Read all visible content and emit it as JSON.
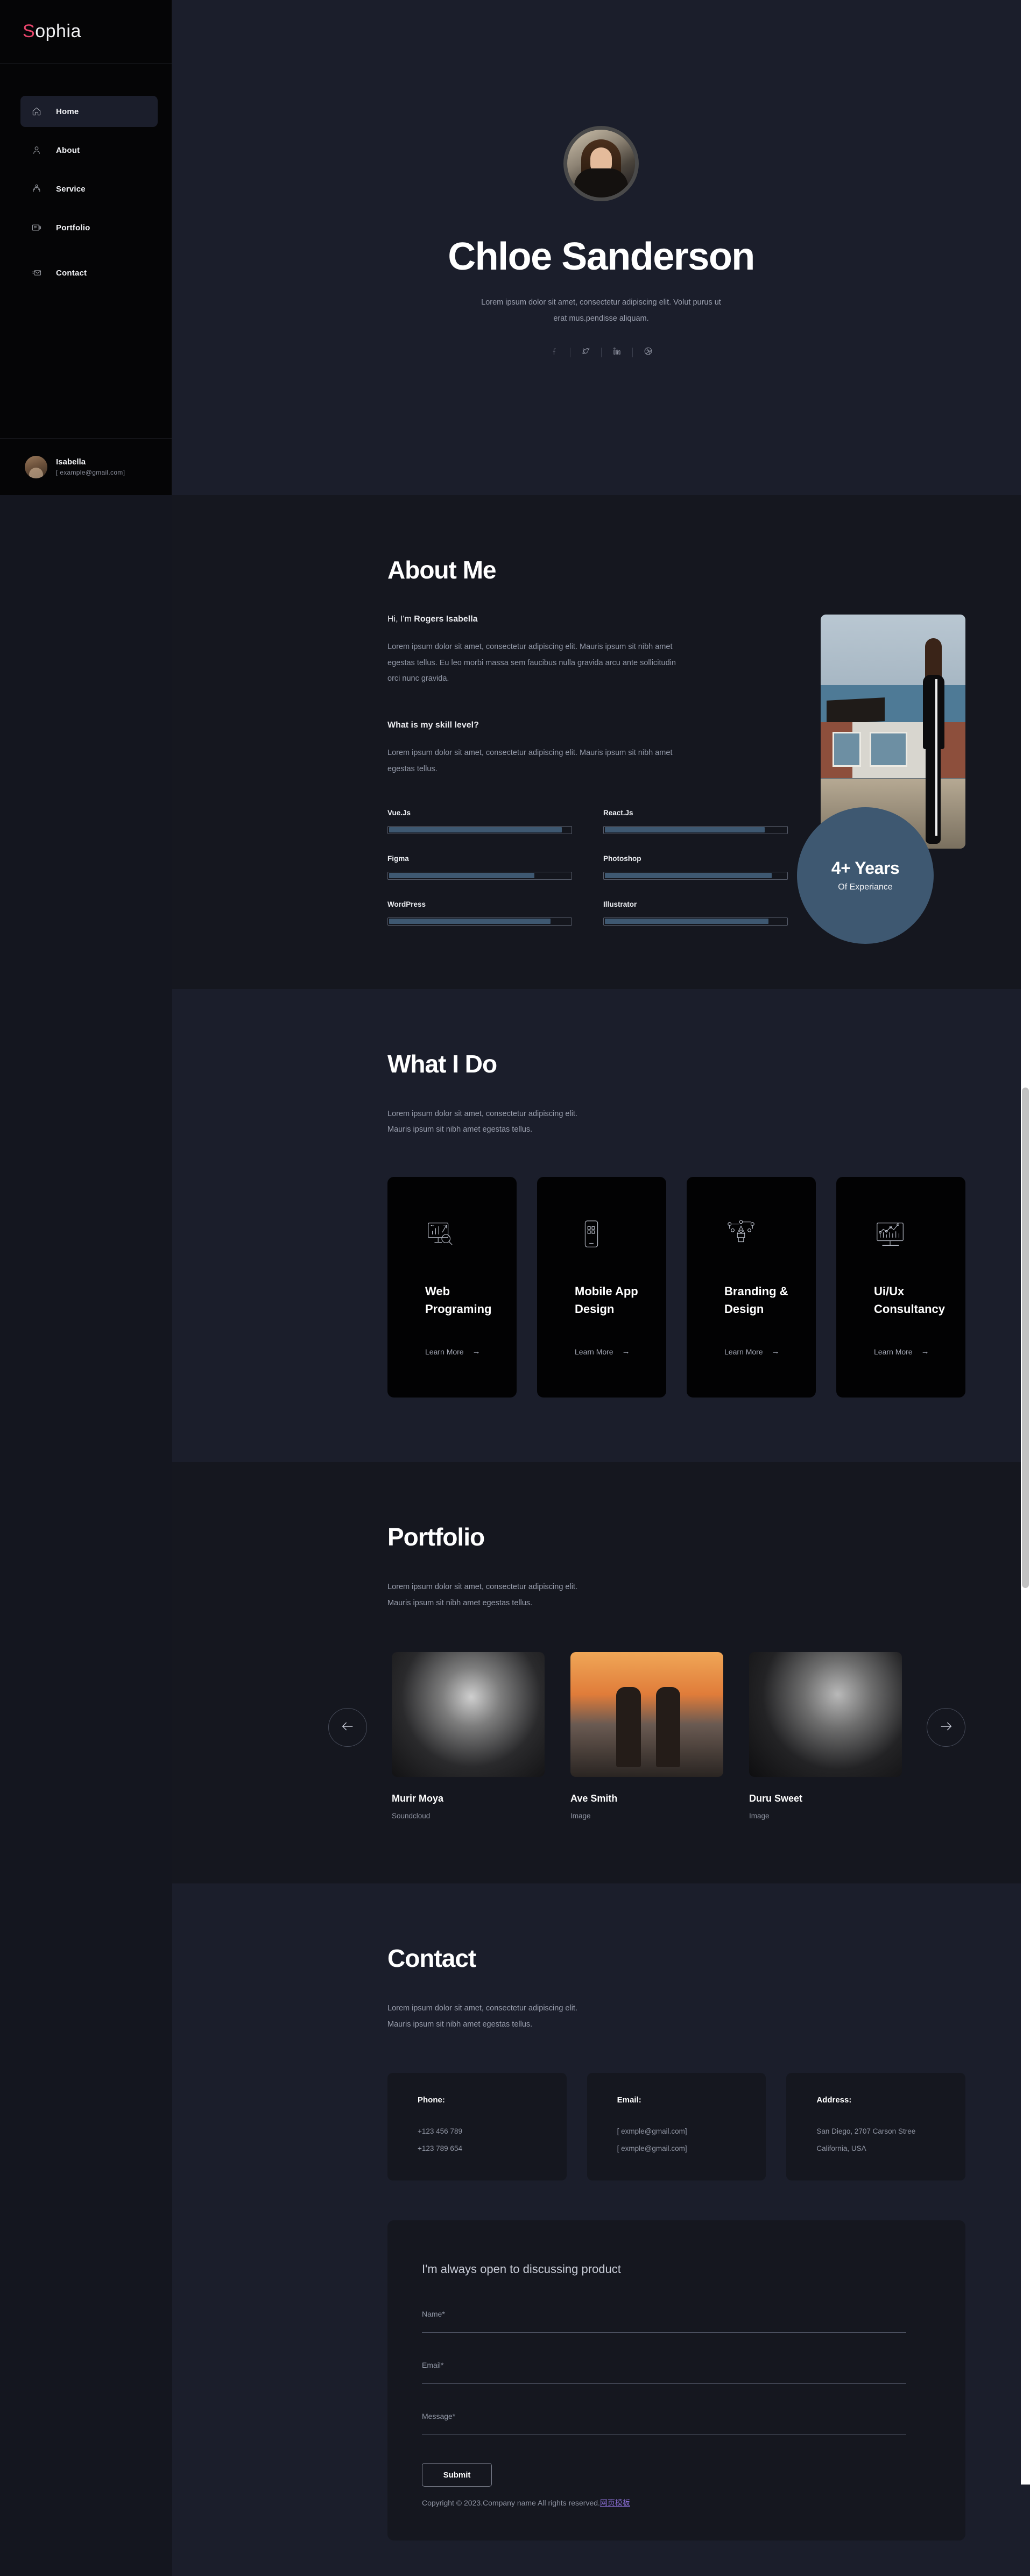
{
  "sidebar": {
    "brand": {
      "accent_letter": "S",
      "rest": "ophia"
    },
    "items": [
      {
        "label": "Home",
        "icon": "home-icon",
        "active": true
      },
      {
        "label": "About",
        "icon": "user-icon",
        "active": false
      },
      {
        "label": "Service",
        "icon": "service-icon",
        "active": false
      },
      {
        "label": "Portfolio",
        "icon": "portfolio-icon",
        "active": false
      },
      {
        "label": "Contact",
        "icon": "mail-icon",
        "active": false
      }
    ],
    "user": {
      "name": "Isabella",
      "email": "[ example@gmail.com]"
    }
  },
  "hero": {
    "name": "Chloe Sanderson",
    "subtitle": "Lorem ipsum dolor sit amet, consectetur adipiscing elit. Volut purus ut erat mus.pendisse aliquam.",
    "socials": [
      "facebook-icon",
      "twitter-icon",
      "linkedin-icon",
      "dribbble-icon"
    ]
  },
  "about": {
    "title": "About Me",
    "greeting_prefix": "Hi, I'm ",
    "greeting_name": "Rogers Isabella",
    "paragraph": "Lorem ipsum dolor sit amet, consectetur adipiscing elit. Mauris ipsum sit nibh amet egestas tellus. Eu leo morbi massa sem faucibus nulla gravida arcu ante sollicitudin orci nunc gravida.",
    "skill_heading": "What is my skill level?",
    "skill_paragraph": "Lorem ipsum dolor sit amet, consectetur adipiscing elit. Mauris ipsum sit nibh amet egestas tellus.",
    "skills": [
      {
        "name": "Vue.Js",
        "percent": 95
      },
      {
        "name": "React.Js",
        "percent": 88
      },
      {
        "name": "Figma",
        "percent": 80
      },
      {
        "name": "Photoshop",
        "percent": 92
      },
      {
        "name": "WordPress",
        "percent": 89
      },
      {
        "name": "Illustrator",
        "percent": 90
      }
    ],
    "badge": {
      "number": "4+ Years",
      "label": "Of Experiance"
    }
  },
  "whatido": {
    "title": "What I Do",
    "lead": "Lorem ipsum dolor sit amet, consectetur adipiscing elit. Mauris ipsum sit nibh amet egestas tellus.",
    "cards": [
      {
        "title": "Web Programing",
        "icon": "monitor-chart-search-icon",
        "more": "Learn More",
        "arrow": "→"
      },
      {
        "title": "Mobile App Design",
        "icon": "smartphone-icon",
        "more": "Learn More",
        "arrow": "→"
      },
      {
        "title": "Branding & Design",
        "icon": "pen-tool-icon",
        "more": "Learn More",
        "arrow": "→"
      },
      {
        "title": "Ui/Ux Consultancy",
        "icon": "monitor-analytics-icon",
        "more": "Learn More",
        "arrow": "→"
      }
    ]
  },
  "portfolio": {
    "title": "Portfolio",
    "lead": "Lorem ipsum dolor sit amet, consectetur adipiscing elit. Mauris ipsum sit nibh amet egestas tellus.",
    "prev_icon": "arrow-left-icon",
    "next_icon": "arrow-right-icon",
    "items": [
      {
        "name": "Murir Moya",
        "tag": "Soundcloud"
      },
      {
        "name": "Ave Smith",
        "tag": "Image"
      },
      {
        "name": "Duru Sweet",
        "tag": "Image"
      }
    ]
  },
  "contact": {
    "title": "Contact",
    "lead": "Lorem ipsum dolor sit amet, consectetur adipiscing elit. Mauris ipsum sit nibh amet egestas tellus.",
    "cards": [
      {
        "label": "Phone:",
        "line1": "+123 456 789",
        "line2": "+123 789 654"
      },
      {
        "label": "Email:",
        "line1": "[ exmple@gmail.com]",
        "line2": "[ exmple@gmail.com]"
      },
      {
        "label": "Address:",
        "line1": "San Diego, 2707 Carson Stree",
        "line2": "California, USA"
      }
    ],
    "form": {
      "title": "I'm always open to discussing product",
      "name_label": "Name*",
      "email_label": "Email*",
      "message_label": "Message*",
      "submit_label": "Submit"
    },
    "copyright_text": "Copyright © 2023.Company name All rights reserved.",
    "copyright_link": "网页模板"
  },
  "colors": {
    "accent_pink": "#e8456b",
    "badge_blue": "#3e5871",
    "bar_fill": "#3e5871",
    "link_purple": "#8b6fd6"
  }
}
